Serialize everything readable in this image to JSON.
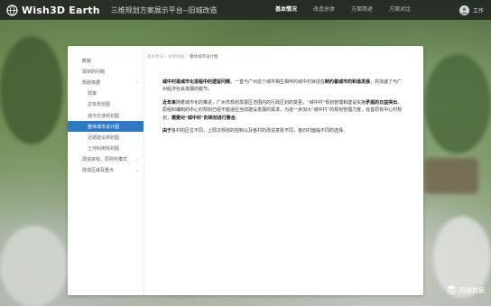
{
  "header": {
    "brand": "Wish3D Earth",
    "system_title": "三维规划方案展示平台--旧城改造",
    "nav": [
      {
        "label": "基本情况",
        "active": true
      },
      {
        "label": "改造总体"
      },
      {
        "label": "方案简述"
      },
      {
        "label": "方案对比"
      }
    ],
    "user_label": "工作"
  },
  "sidebar": {
    "items": [
      {
        "label": "概貌",
        "sub": false
      },
      {
        "label": "现状的问题",
        "sub": false
      },
      {
        "label": "规划依据",
        "sub": false,
        "expandable": true
      },
      {
        "label": "政策",
        "sub": true
      },
      {
        "label": "总体规划图",
        "sub": true
      },
      {
        "label": "城市交通规划图",
        "sub": true
      },
      {
        "label": "整体城市设计图",
        "sub": true,
        "active": true
      },
      {
        "label": "近期建设规划图",
        "sub": true
      },
      {
        "label": "土地利用规划图",
        "sub": true
      },
      {
        "label": "改造目标、原则与模式",
        "sub": false,
        "expandable": true
      },
      {
        "label": "改造区域及重点",
        "sub": false,
        "expandable": true
      }
    ]
  },
  "breadcrumb": {
    "items": [
      "基本情况",
      "规划依据",
      "整体城市设计图"
    ]
  },
  "content": {
    "p1": {
      "b1": "城中村是城市化进程中的遗留问题",
      "t1": "，一直与广州这个城市相生相伴的城中村目前在",
      "b2": "制约着城市的和谐发展",
      "t2": "，并加速了与广州经济社会发展的脱节。"
    },
    "p2": {
      "b1": "近年来",
      "t1": "随着城市化的推进，广州市规划发展区范围内的行政区划的变更，“城中村”规划管理和建设实施",
      "b2": "矛盾的日益突出",
      "t2": "。原组织编制的中心村规划已经不能适应当前建设发展的需求，为进一步加大“城中村”的规划管理力度，完善原有中心村规划，",
      "b3": "需要对“城中村”的规划进行整合",
      "t3": "。"
    },
    "p3": {
      "b1": "由于",
      "t1": "各村的区位不同，上层次规划的控制以及各村的改造意愿不同，各旧村面临不同的选择。"
    }
  },
  "watermark": {
    "text": "四维数据"
  },
  "colors": {
    "accent": "#2f78c4",
    "topbar": "#1c201e"
  },
  "icons": {
    "logo": "globe-logo-icon",
    "user": "user-avatar-icon",
    "watermark": "cube-logo-icon",
    "chevron": "chevron-down-icon"
  }
}
